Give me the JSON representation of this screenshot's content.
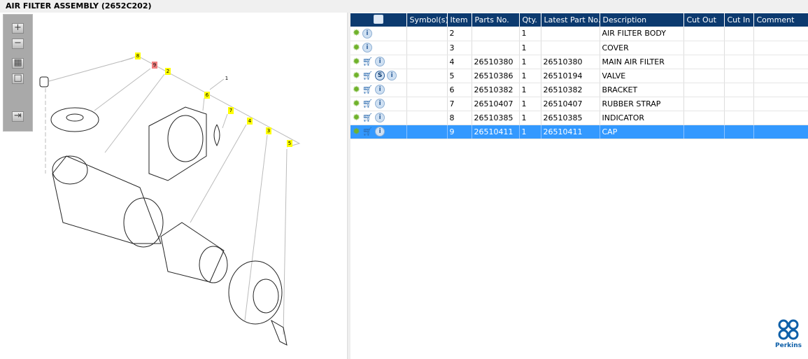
{
  "title": "AIR FILTER ASSEMBLY (2652C202)",
  "toolbar": {
    "zoom_in": "+",
    "zoom_out": "−",
    "fit": "▦",
    "actual": "□",
    "export": "⇥"
  },
  "callouts": [
    {
      "label": "8",
      "color": "#ffff00"
    },
    {
      "label": "9",
      "color": "#f08080"
    },
    {
      "label": "2",
      "color": "#ffff00"
    },
    {
      "label": "1",
      "color": "none"
    },
    {
      "label": "6",
      "color": "#ffff00"
    },
    {
      "label": "7",
      "color": "#ffff00"
    },
    {
      "label": "4",
      "color": "#ffff00"
    },
    {
      "label": "3",
      "color": "#ffff00"
    },
    {
      "label": "5",
      "color": "#ffff00"
    }
  ],
  "table": {
    "headers": [
      "",
      "Symbol(s)",
      "Item",
      "Parts No.",
      "Qty.",
      "Latest Part No.",
      "Description",
      "Cut Out",
      "Cut In",
      "Comment"
    ],
    "rows": [
      {
        "icons": [
          "gear",
          "info"
        ],
        "item": "2",
        "parts_no": "",
        "qty": "1",
        "latest": "",
        "desc": "AIR FILTER BODY"
      },
      {
        "icons": [
          "gear",
          "info"
        ],
        "item": "3",
        "parts_no": "",
        "qty": "1",
        "latest": "",
        "desc": "COVER"
      },
      {
        "icons": [
          "gear",
          "cart",
          "info"
        ],
        "item": "4",
        "parts_no": "26510380",
        "qty": "1",
        "latest": "26510380",
        "desc": "MAIN AIR FILTER"
      },
      {
        "icons": [
          "gear",
          "cart",
          "S",
          "info"
        ],
        "item": "5",
        "parts_no": "26510386",
        "qty": "1",
        "latest": "26510194",
        "desc": "VALVE"
      },
      {
        "icons": [
          "gear",
          "cart",
          "info"
        ],
        "item": "6",
        "parts_no": "26510382",
        "qty": "1",
        "latest": "26510382",
        "desc": "BRACKET"
      },
      {
        "icons": [
          "gear",
          "cart",
          "info"
        ],
        "item": "7",
        "parts_no": "26510407",
        "qty": "1",
        "latest": "26510407",
        "desc": "RUBBER STRAP"
      },
      {
        "icons": [
          "gear",
          "cart",
          "info"
        ],
        "item": "8",
        "parts_no": "26510385",
        "qty": "1",
        "latest": "26510385",
        "desc": "INDICATOR"
      },
      {
        "icons": [
          "gear",
          "cart",
          "info"
        ],
        "item": "9",
        "parts_no": "26510411",
        "qty": "1",
        "latest": "26510411",
        "desc": "CAP",
        "selected": true
      }
    ]
  },
  "logo": "Perkins"
}
